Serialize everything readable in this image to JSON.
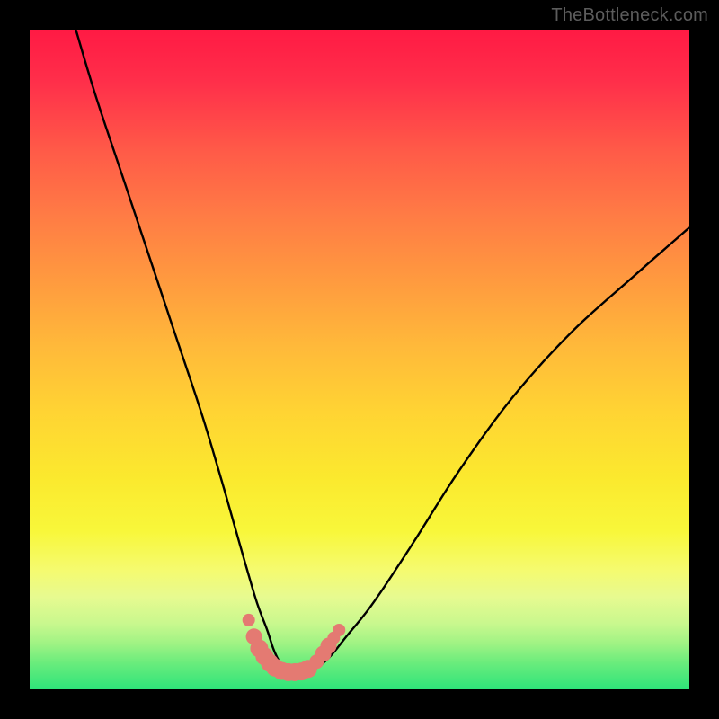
{
  "watermark": "TheBottleneck.com",
  "colors": {
    "frame": "#000000",
    "curve": "#000000",
    "marker": "#e47a72",
    "gradient_top": "#ff1a44",
    "gradient_bottom": "#2ee47a"
  },
  "chart_data": {
    "type": "line",
    "title": "",
    "xlabel": "",
    "ylabel": "",
    "xlim": [
      0,
      100
    ],
    "ylim": [
      0,
      100
    ],
    "grid": false,
    "series": [
      {
        "name": "bottleneck-curve",
        "x": [
          7,
          10,
          14,
          18,
          22,
          26,
          29,
          31,
          33,
          34.5,
          36,
          37,
          38,
          39,
          40,
          41.5,
          43,
          44.5,
          46,
          48,
          52,
          58,
          65,
          73,
          82,
          92,
          100
        ],
        "y": [
          100,
          90,
          78,
          66,
          54,
          42,
          32,
          25,
          18,
          13,
          9,
          6,
          4,
          3,
          2.5,
          2.5,
          3,
          4,
          5.5,
          8,
          13,
          22,
          33,
          44,
          54,
          63,
          70
        ]
      }
    ],
    "markers": {
      "name": "highlight-points",
      "x": [
        33.2,
        34.0,
        34.8,
        35.6,
        36.4,
        37.2,
        38.2,
        39.2,
        40.2,
        41.2,
        42.2,
        43.5,
        44.5,
        45.3,
        46.1,
        46.9
      ],
      "y": [
        10.5,
        8.0,
        6.2,
        5.0,
        4.0,
        3.3,
        2.8,
        2.6,
        2.6,
        2.7,
        3.1,
        4.2,
        5.4,
        6.6,
        7.8,
        9.0
      ],
      "r": [
        7,
        9,
        10,
        10,
        10,
        10,
        10,
        10,
        10,
        10,
        10,
        8,
        9,
        9,
        7,
        7
      ]
    }
  }
}
